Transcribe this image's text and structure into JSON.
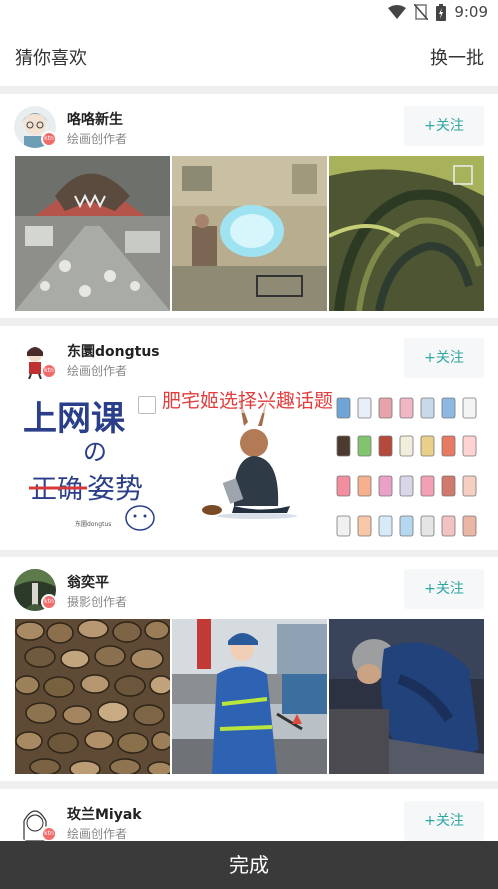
{
  "status": {
    "time": "9:09"
  },
  "header": {
    "title": "猜你喜欢",
    "refresh_label": "换一批"
  },
  "cards": [
    {
      "name": "咯咯新生",
      "role": "绘画创作者",
      "follow_label": "+关注",
      "badge": "ktn",
      "thumbs": [
        "monster-city-illustration",
        "office-room-illustration",
        "green-swirl-illustration"
      ]
    },
    {
      "name": "东圜dongtus",
      "role": "绘画创作者",
      "follow_label": "+关注",
      "badge": "ktn",
      "thumbs": [
        "online-class-posture-drawing",
        "rabbit-girl-drawing",
        "jars-chart-drawing"
      ],
      "thumb_texts": {
        "title_line1": "上网课",
        "title_line2": "の",
        "strike": "正确",
        "word": "姿势",
        "signature": "东圜dongtus"
      }
    },
    {
      "name": "翁奕平",
      "role": "摄影创作者",
      "follow_label": "+关注",
      "badge": "ktn",
      "thumbs": [
        "firewood-stack-photo",
        "sanitation-worker-photo",
        "sleeping-man-photo"
      ]
    },
    {
      "name": "玫兰Miyak",
      "role": "绘画创作者",
      "follow_label": "+关注",
      "badge": "ktn",
      "thumbs": []
    }
  ],
  "overlay": {
    "text": "肥宅姬选择兴趣话题"
  },
  "footer": {
    "done_label": "完成"
  },
  "colors": {
    "accent": "#2fa6a0",
    "badge": "#f16b6b",
    "footer_bg": "#3a3a3a",
    "divider": "#efefef"
  }
}
